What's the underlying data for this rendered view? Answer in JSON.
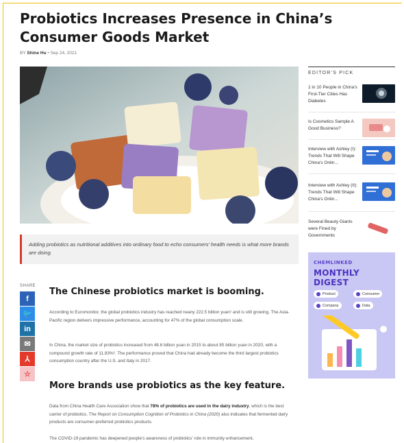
{
  "article": {
    "title": "Probiotics Increases Presence in China’s Consumer Goods Market",
    "byline_prefix": "BY",
    "author": "Shine Hu",
    "separator": "•",
    "date": "Sep 24, 2021",
    "caption": "Adding probiotics as nutritional additives into ordinary food to echo consumers’ health needs is what more brands are doing."
  },
  "share": {
    "label": "SHARE",
    "buttons": [
      {
        "icon": "facebook-icon",
        "glyph": "f",
        "color": "#2c63b6"
      },
      {
        "icon": "twitter-icon",
        "glyph": "🐦",
        "color": "#2c8ee8"
      },
      {
        "icon": "linkedin-icon",
        "glyph": "in",
        "color": "#1e72a6"
      },
      {
        "icon": "email-icon",
        "glyph": "✉",
        "color": "#7a7a7a"
      },
      {
        "icon": "pdf-icon",
        "glyph": "⅄",
        "color": "#e43a2c"
      },
      {
        "icon": "favorite-star-icon",
        "glyph": "☆",
        "color": "#f6c4c6"
      }
    ]
  },
  "sections": [
    {
      "heading": "The Chinese probiotics market is booming.",
      "paragraphs": [
        "According to Euromonitor, the global probiotics industry has reached neany 222.5 billion yuan¹ and is still growing. The Asia-Pacific region delivers impressive performance, accounting for 47% of the global consumption scale.",
        "In China, the market size of probiotics increased from 48.6 billion yuan in 2015 to about 85 billion yuan in 2020, with a compound growth rate of 11.83%². The performance proved that China had already become the third largest probiotics consumption country after the U.S. and Italy in 2017."
      ]
    },
    {
      "heading": "More brands use probiotics as the key feature.",
      "p1_before": "Data from China Health Care Association show that ",
      "p1_bold": "78% of probiotics are used in the dairy industry",
      "p1_mid": ", which is the best carrier of probiotics. The ",
      "p1_italic": "Report on Consumption Cognition of Probiotics in China (2020)",
      "p1_after": " also indicates that fermented dairy products are consumer-preferred probiotics products.",
      "p2": "The COVID-19 pandemic has deepened people’s awareness of probiotics’ role in immunity enhancement,"
    }
  ],
  "sidebar": {
    "heading": "EDITOR’S PICK",
    "picks": [
      {
        "title": "1 in 10 People in China’s First-Tier Cities Has Diabetes"
      },
      {
        "title": "Is Cosmetics Sample A Good Business?"
      },
      {
        "title": "Interview with Ashley (I): Trends That Will Shape China’s Onlin..."
      },
      {
        "title": "Interview with Ashley (II): Trends That Will Shape China’s Onlin..."
      },
      {
        "title": "Several Beauty Giants were Fined by Governments"
      }
    ],
    "digest": {
      "brand": "CHEMLINKED",
      "title": "MONTHLY DIGEST",
      "chips": [
        "Product",
        "Consumer",
        "Company",
        "Data"
      ]
    }
  }
}
